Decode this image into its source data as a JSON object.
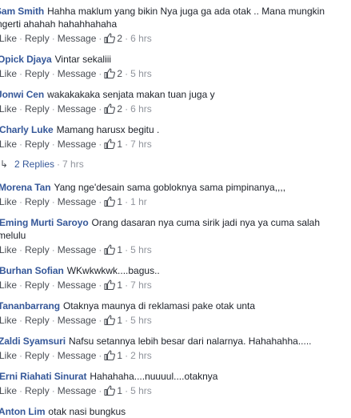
{
  "labels": {
    "like": "Like",
    "reply": "Reply",
    "message": "Message",
    "sep": "·"
  },
  "comments": [
    {
      "author": "Sam Smith",
      "text": "Hahha maklum yang bikin Nya juga ga ada otak .. Mana mungkin",
      "text2": "ngerti ahahah hahahhahaha",
      "likes": "2",
      "time": "6 hrs"
    },
    {
      "author": "Opick Djaya",
      "text": "Vintar sekaliii",
      "likes": "2",
      "time": "5 hrs"
    },
    {
      "author": "Jonwi Cen",
      "text": "wakakakaka senjata makan tuan juga y",
      "likes": "2",
      "time": "6 hrs"
    },
    {
      "author": "Charly Luke",
      "text": "Mamang harusx begitu .",
      "likes": "1",
      "time": "7 hrs"
    },
    {
      "author": "Morena Tan",
      "text": "Yang nge'desain sama gobloknya sama pimpinanya,,,,",
      "likes": "1",
      "time": "1 hr"
    },
    {
      "author": "Eming Murti Saroyo",
      "text": "Orang dasaran nya cuma sirik jadi nya ya cuma salah",
      "text2": "melulu",
      "likes": "1",
      "time": "5 hrs"
    },
    {
      "author": "Burhan Sofian",
      "text": "WKwkwkwk....bagus..",
      "likes": "1",
      "time": "7 hrs"
    },
    {
      "author": "Tananbarrang",
      "text": "Otaknya maunya di reklamasi pake otak unta",
      "likes": "1",
      "time": "5 hrs"
    },
    {
      "author": "Zaldi Syamsuri",
      "text": "Nafsu setannya lebih besar dari nalarnya. Hahahahha.....",
      "likes": "1",
      "time": "2 hrs"
    },
    {
      "author": "Erni Riahati Sinurat",
      "text": "Hahahaha....nuuuul....otaknya",
      "likes": "1",
      "time": "5 hrs"
    },
    {
      "author": "Anton Lim",
      "text": "otak nasi bungkus"
    }
  ],
  "replies": {
    "arrow": "↳",
    "label": "2 Replies",
    "time": "7 hrs"
  },
  "colors": {
    "author": "#365899",
    "meta": "#90949c",
    "text": "#1d2129",
    "like_icon": "#4b4f56"
  }
}
